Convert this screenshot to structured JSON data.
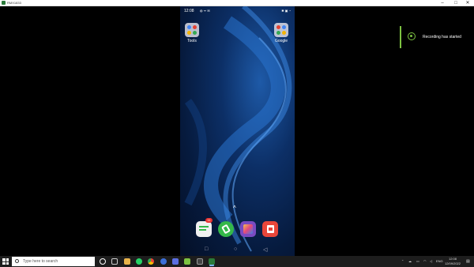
{
  "window": {
    "title": "RMX1833",
    "minimize": "–",
    "maximize": "□",
    "close": "✕"
  },
  "phone": {
    "status": {
      "time": "12:08",
      "left_icons": "◍ ᯤ ✉",
      "right_icons": "✱ ▣ ◔"
    },
    "folders": [
      {
        "label": "Tools"
      },
      {
        "label": "Google"
      }
    ],
    "swipe_up": "^",
    "dock": [
      {
        "name": "messages",
        "badge": "11",
        "color": "#f0f0f0"
      },
      {
        "name": "phone",
        "color": "#34b84a"
      },
      {
        "name": "theme-store",
        "color": "#7a4bc2"
      },
      {
        "name": "app-market",
        "color": "#e8463a"
      }
    ],
    "nav": {
      "recents": "□",
      "home": "○",
      "back": "◁"
    }
  },
  "toast": {
    "message": "Recording has started"
  },
  "taskbar": {
    "search_placeholder": "Type here to search",
    "tray_language": "ENG",
    "clock_time": "12:08",
    "clock_date": "12/09/2022"
  },
  "colors": {
    "accent_green": "#7dc242",
    "taskbar_bg": "#1d1d1d"
  }
}
